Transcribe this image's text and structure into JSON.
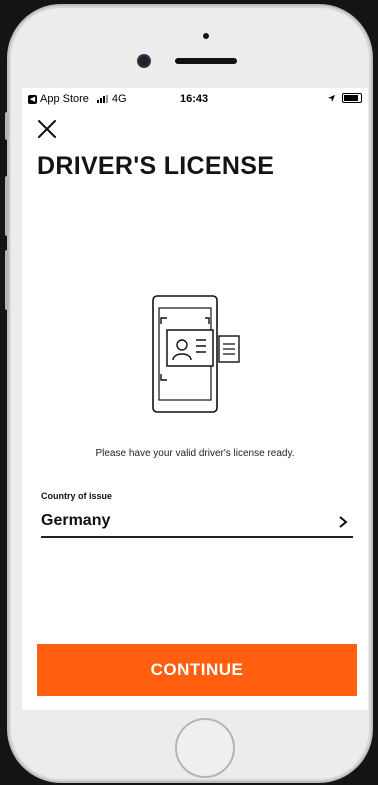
{
  "status_bar": {
    "back_app": "App Store",
    "network": "4G",
    "time": "16:43"
  },
  "page": {
    "title": "DRIVER'S LICENSE",
    "hint": "Please have your valid driver's license ready."
  },
  "form": {
    "country_label": "Country of issue",
    "country_value": "Germany"
  },
  "actions": {
    "continue_label": "CONTINUE"
  },
  "colors": {
    "accent": "#ff5f0f"
  },
  "icons": [
    "close-icon",
    "license-phone-icon",
    "chevron-right-icon",
    "location-arrow-icon",
    "battery-icon",
    "signal-icon"
  ]
}
